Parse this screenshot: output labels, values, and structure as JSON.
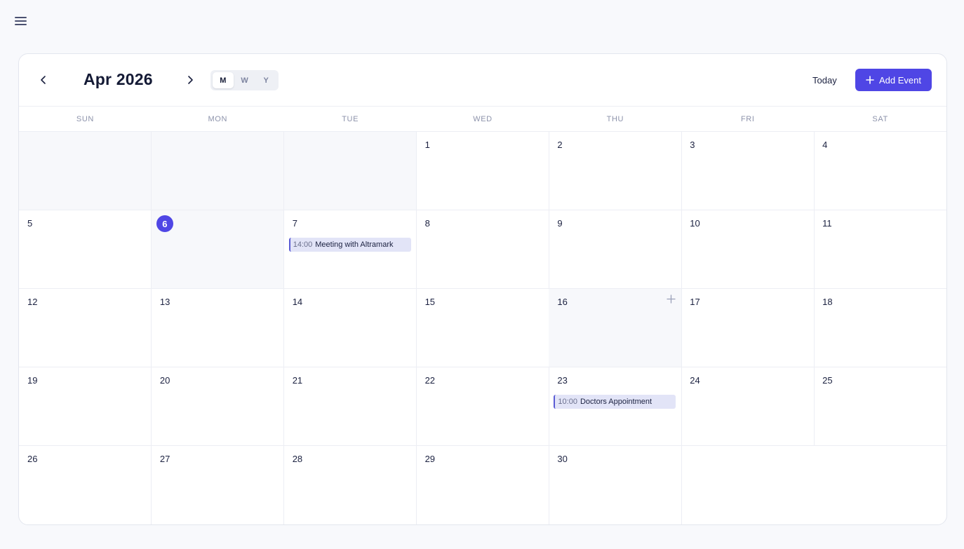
{
  "header": {
    "menu_icon": "hamburger-menu-icon"
  },
  "calendar": {
    "title": "Apr 2026",
    "prev_icon": "chevron-left-icon",
    "next_icon": "chevron-right-icon",
    "views": [
      {
        "label": "M",
        "active": true
      },
      {
        "label": "W",
        "active": false
      },
      {
        "label": "Y",
        "active": false
      }
    ],
    "today_label": "Today",
    "add_event_label": "Add Event",
    "add_event_icon": "plus-icon",
    "accent_color": "#4f46e5",
    "weekdays": [
      "SUN",
      "MON",
      "TUE",
      "WED",
      "THU",
      "FRI",
      "SAT"
    ],
    "today": 6,
    "hovered_day": 16,
    "weeks": [
      [
        "",
        "",
        "",
        "1",
        "2",
        "3",
        "4"
      ],
      [
        "5",
        "6",
        "7",
        "8",
        "9",
        "10",
        "11"
      ],
      [
        "12",
        "13",
        "14",
        "15",
        "16",
        "17",
        "18"
      ],
      [
        "19",
        "20",
        "21",
        "22",
        "23",
        "24",
        "25"
      ],
      [
        "26",
        "27",
        "28",
        "29",
        "30",
        "",
        ""
      ]
    ],
    "events": [
      {
        "day": 7,
        "time": "14:00",
        "title": "Meeting with Altramark"
      },
      {
        "day": 23,
        "time": "10:00",
        "title": "Doctors Appointment"
      }
    ]
  }
}
